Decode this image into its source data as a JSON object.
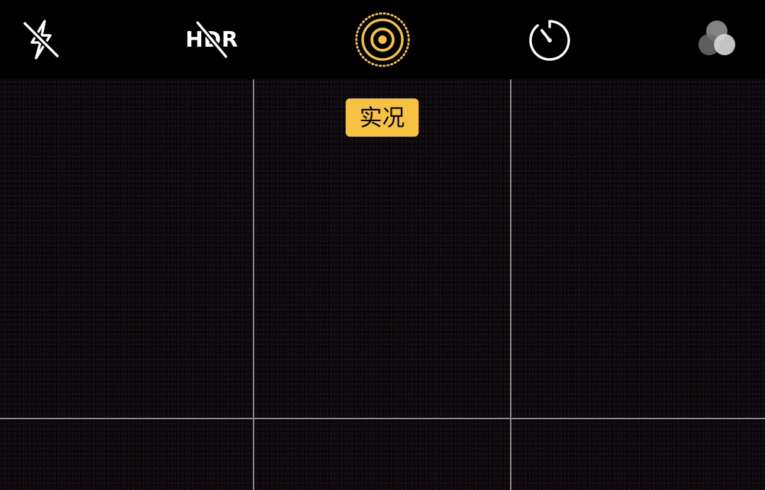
{
  "toolbar": {
    "hdr_label": "HDR"
  },
  "live_badge": {
    "label": "实况"
  },
  "colors": {
    "accent_yellow": "#f5c242",
    "icon_white": "#ffffff",
    "grid_line": "#8a8a8a",
    "background": "#000000"
  },
  "icons": {
    "flash": "flash-off-icon",
    "hdr": "hdr-off-icon",
    "live": "live-photo-icon",
    "timer": "timer-icon",
    "filters": "filters-icon"
  }
}
